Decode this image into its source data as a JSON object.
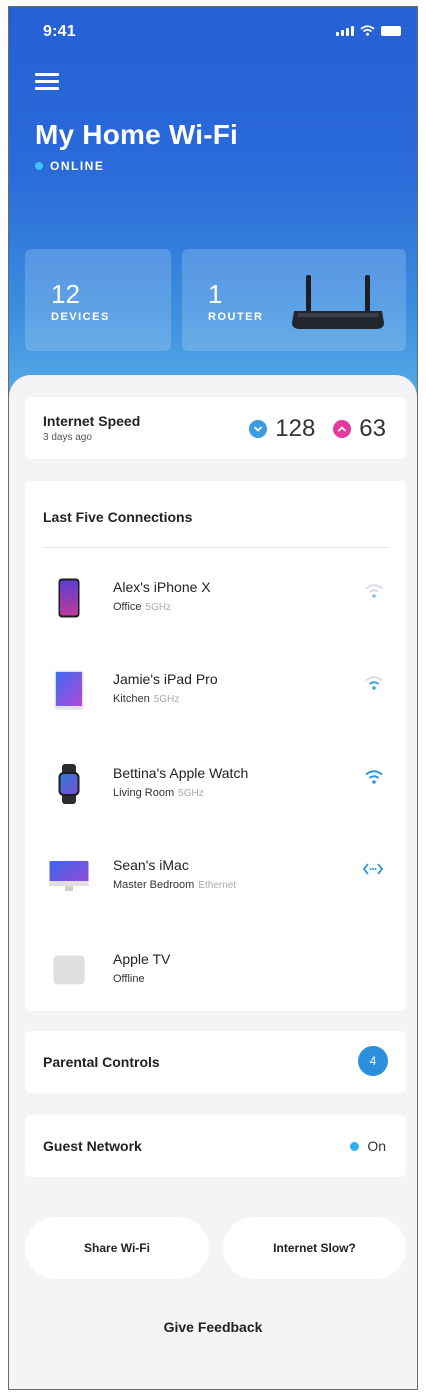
{
  "status_bar": {
    "time": "9:41"
  },
  "header": {
    "title": "My Home Wi-Fi",
    "status": "ONLINE",
    "stats": [
      {
        "number": "12",
        "label": "DEVICES"
      },
      {
        "number": "1",
        "label": "ROUTER"
      }
    ]
  },
  "speed": {
    "title": "Internet Speed",
    "subtitle": "3 days ago",
    "download": "128",
    "upload": "63"
  },
  "connections": {
    "title": "Last Five Connections",
    "items": [
      {
        "name": "Alex's iPhone X",
        "location": "Office",
        "band": "5GHz",
        "icon": "phone-icon",
        "signal": "wifi-low"
      },
      {
        "name": "Jamie's iPad Pro",
        "location": "Kitchen",
        "band": "5GHz",
        "icon": "tablet-icon",
        "signal": "wifi-medium"
      },
      {
        "name": "Bettina's Apple Watch",
        "location": "Living Room",
        "band": "5GHz",
        "icon": "watch-icon",
        "signal": "wifi-full"
      },
      {
        "name": "Sean's iMac",
        "location": "Master Bedroom",
        "band": "Ethernet",
        "icon": "desktop-icon",
        "signal": "ethernet"
      },
      {
        "name": "Apple TV",
        "location": "Offline",
        "band": "",
        "icon": "tv-box-icon",
        "signal": "none"
      }
    ]
  },
  "parental_controls": {
    "label": "Parental Controls",
    "count": "4"
  },
  "guest_network": {
    "label": "Guest Network",
    "state": "On"
  },
  "actions": {
    "share_wifi": "Share Wi-Fi",
    "internet_slow": "Internet Slow?",
    "feedback": "Give Feedback"
  },
  "colors": {
    "header_top": "#2560d6",
    "header_bottom": "#59aee6",
    "download": "#3c9be3",
    "upload": "#e43aa0",
    "accent": "#2b8fde"
  }
}
